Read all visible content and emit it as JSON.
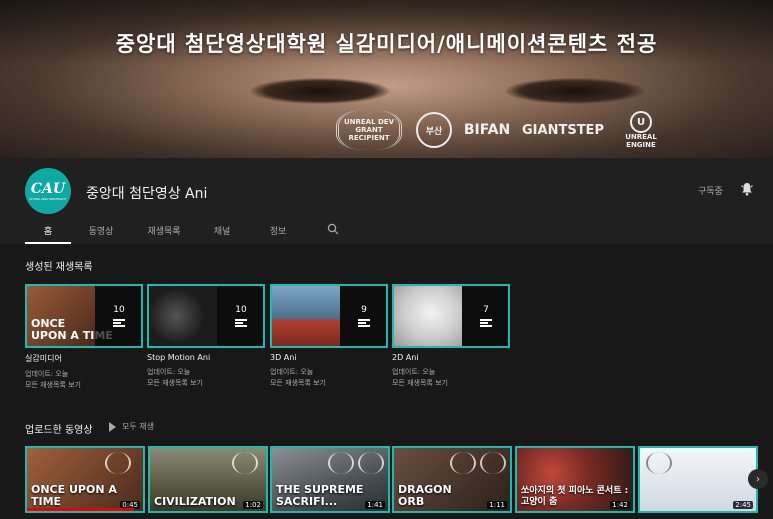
{
  "banner": {
    "title": "중앙대 첨단영상대학원 실감미디어/애니메이션콘텐츠 전공",
    "logos": [
      {
        "name": "unreal-dev-grant",
        "text": "UNREAL DEV GRANT RECIPIENT"
      },
      {
        "name": "festival-seal",
        "text": "부산"
      },
      {
        "name": "bifan",
        "text": "BIFAN"
      },
      {
        "name": "giantstep",
        "text": "GIANTSTEP"
      },
      {
        "name": "unreal-engine",
        "text": "UNREAL ENGINE"
      }
    ]
  },
  "channel": {
    "avatar_text": "CAU",
    "avatar_sub": "CHUNG-ANG UNIVERSITY",
    "name": "중앙대 첨단영상 Ani",
    "subscribed_label": "구독중"
  },
  "tabs": [
    "홈",
    "동영상",
    "재생목록",
    "채널",
    "정보"
  ],
  "sections": {
    "playlists_title": "생성된 재생목록",
    "uploads_title": "업로드한 동영상",
    "play_all": "모두 재생"
  },
  "playlists": [
    {
      "name": "실감미디어",
      "count": "10",
      "updated": "업데이트: 오늘",
      "view_all": "모든 재생목록 보기",
      "overlay": "ONCE\nUPON A TIME",
      "color": "#7a4a30"
    },
    {
      "name": "Stop Motion Ani",
      "count": "10",
      "updated": "업데이트: 오늘",
      "view_all": "모든 재생목록 보기",
      "overlay": "",
      "color": "#262626"
    },
    {
      "name": "3D Ani",
      "count": "9",
      "updated": "업데이트: 오늘",
      "view_all": "모든 재생목록 보기",
      "overlay": "",
      "color": "#4a6e8e"
    },
    {
      "name": "2D Ani",
      "count": "7",
      "updated": "업데이트: 오늘",
      "view_all": "모든 재생목록 보기",
      "overlay": "",
      "color": "#d8d8d8"
    }
  ],
  "videos": [
    {
      "title": "ONCE UPON A TIME",
      "duration": "0:45",
      "color": "#7a4a30",
      "progress": 0.92
    },
    {
      "title": "CIVILIZATION",
      "duration": "1:02",
      "color": "#6a6a50",
      "progress": 0
    },
    {
      "title": "THE SUPREME SACRIFI...",
      "duration": "1:41",
      "color": "#5a6064",
      "progress": 0
    },
    {
      "title": "DRAGON ORB",
      "duration": "1:11",
      "color": "#4e3a32",
      "progress": 0
    },
    {
      "title": "쏘아지의 첫 피아노 콘서트 : 고양이 춤",
      "duration": "1:42",
      "color": "#8a3030",
      "progress": 0
    },
    {
      "title": "",
      "duration": "2:45",
      "color": "#dfe6ee",
      "progress": 0
    }
  ]
}
